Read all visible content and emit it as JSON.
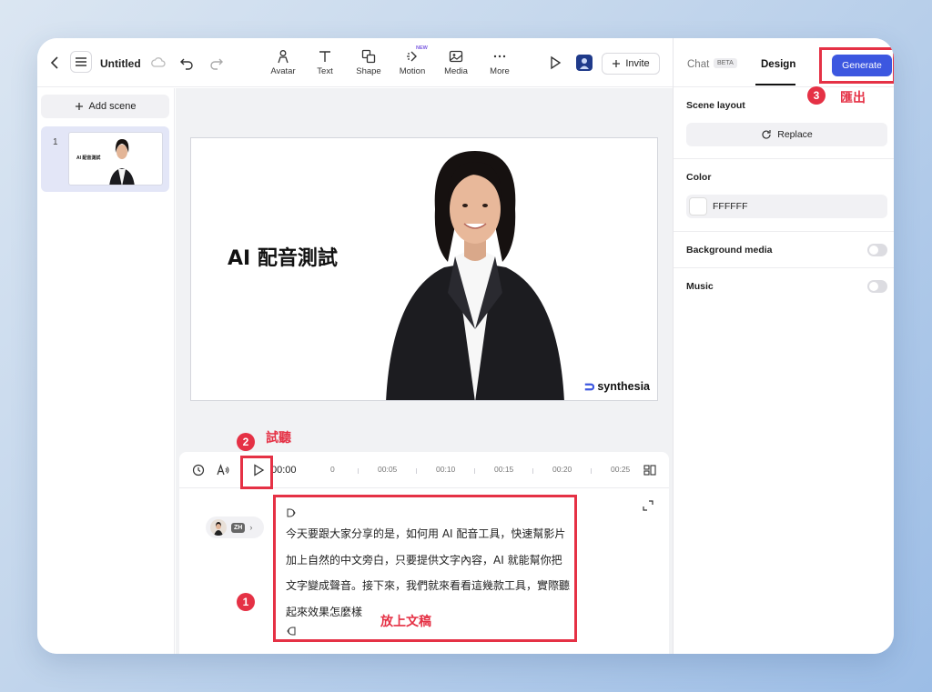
{
  "toolbar": {
    "title": "Untitled",
    "tools": [
      {
        "label": "Avatar",
        "icon": "avatar-icon"
      },
      {
        "label": "Text",
        "icon": "text-icon"
      },
      {
        "label": "Shape",
        "icon": "shape-icon"
      },
      {
        "label": "Motion",
        "icon": "motion-icon",
        "badge": "NEW"
      },
      {
        "label": "Media",
        "icon": "media-icon"
      },
      {
        "label": "More",
        "icon": "more-icon"
      }
    ],
    "invite_label": "Invite"
  },
  "sidebar": {
    "add_scene_label": "Add scene",
    "scenes": [
      {
        "number": "1",
        "thumb_title": "AI 配音測試"
      }
    ]
  },
  "slide": {
    "title": "AI 配音測試",
    "logo_text": "synthesia"
  },
  "timeline": {
    "current_time": "00:00",
    "ticks": [
      "0",
      "00:05",
      "00:10",
      "00:15",
      "00:20",
      "00:25"
    ]
  },
  "script": {
    "language_badge": "ZH",
    "lines": [
      "今天要跟大家分享的是，如何用 AI 配音工具，快速幫影片",
      "加上自然的中文旁白，只要提供文字內容，AI 就能幫你把",
      "文字變成聲音。接下來，我們就來看看這幾款工具，實際聽",
      "起來效果怎麼樣"
    ]
  },
  "panel": {
    "tab_chat": "Chat",
    "tab_chat_badge": "BETA",
    "tab_design": "Design",
    "generate_label": "Generate",
    "scene_layout_label": "Scene layout",
    "replace_label": "Replace",
    "color_label": "Color",
    "color_value": "FFFFFF",
    "background_media_label": "Background media",
    "music_label": "Music"
  },
  "annotations": {
    "step1_num": "1",
    "step1_text": "放上文稿",
    "step2_num": "2",
    "step2_text": "試聽",
    "step3_num": "3",
    "step3_text": "匯出"
  },
  "colors": {
    "accent": "#3c57e0",
    "annotation": "#e53145"
  }
}
